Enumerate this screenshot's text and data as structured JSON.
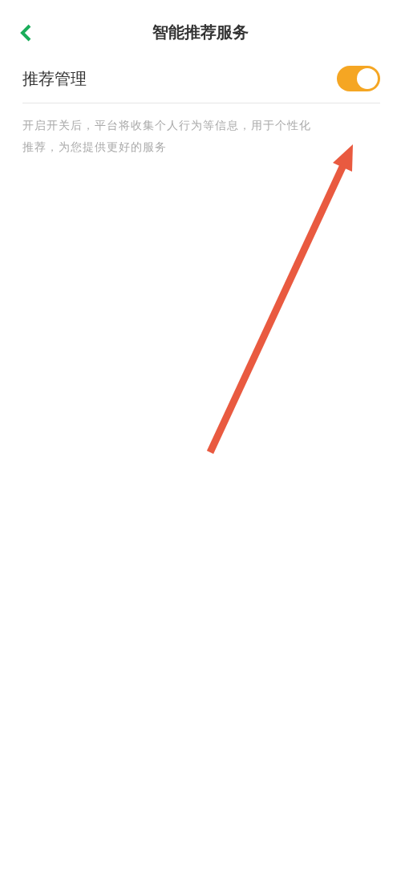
{
  "nav": {
    "title": "智能推荐服务"
  },
  "setting": {
    "label": "推荐管理",
    "on": true
  },
  "description": "开启开关后，平台将收集个人行为等信息，用于个性化推荐，为您提供更好的服务"
}
